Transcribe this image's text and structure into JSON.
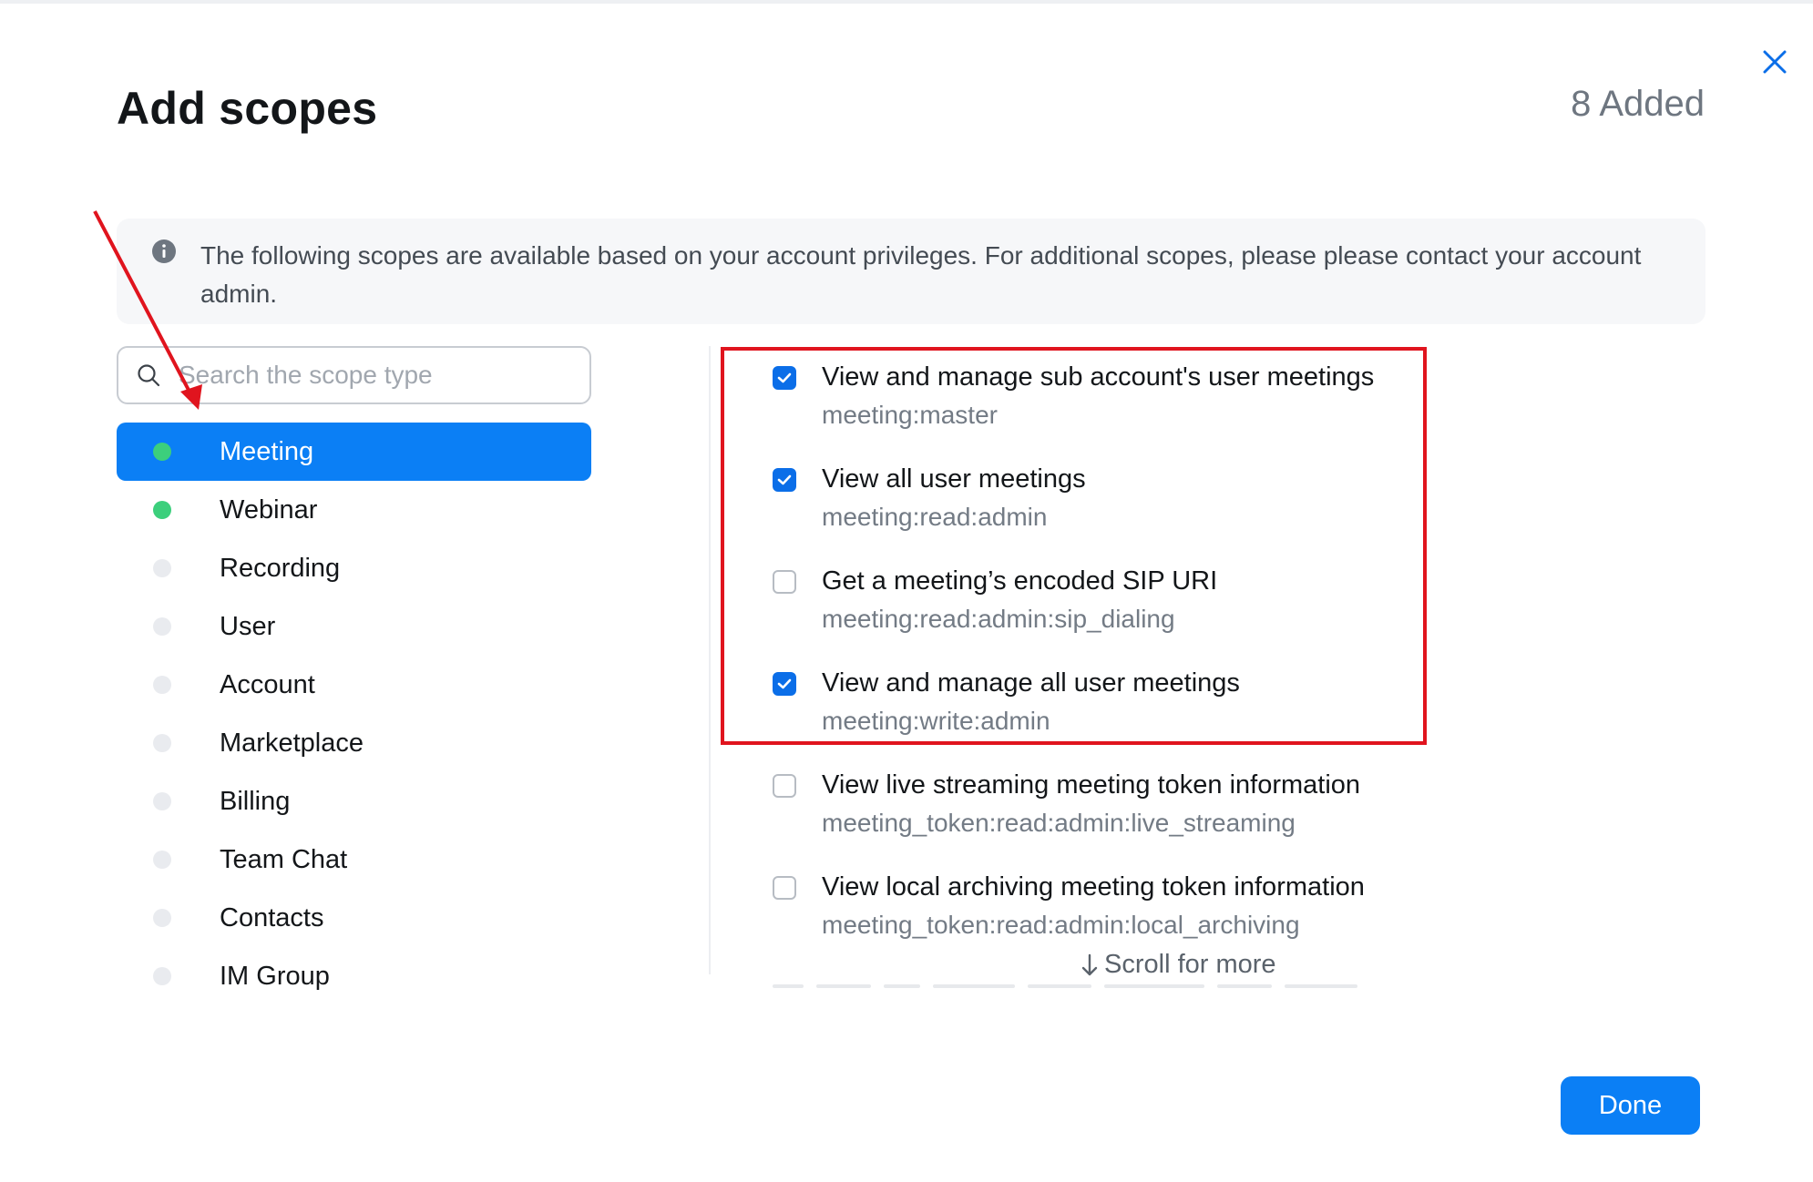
{
  "dialog": {
    "title": "Add scopes",
    "added_count": "8 Added",
    "close_icon": "close-icon",
    "notice_text": "The following scopes are available based on your account privileges. For additional scopes, please please contact your account admin.",
    "notice_icon": "info-icon"
  },
  "search": {
    "placeholder": "Search the scope type",
    "value": ""
  },
  "categories": [
    {
      "label": "Meeting",
      "status": "added",
      "active": true
    },
    {
      "label": "Webinar",
      "status": "added",
      "active": false
    },
    {
      "label": "Recording",
      "status": "none",
      "active": false
    },
    {
      "label": "User",
      "status": "none",
      "active": false
    },
    {
      "label": "Account",
      "status": "none",
      "active": false
    },
    {
      "label": "Marketplace",
      "status": "none",
      "active": false
    },
    {
      "label": "Billing",
      "status": "none",
      "active": false
    },
    {
      "label": "Team Chat",
      "status": "none",
      "active": false
    },
    {
      "label": "Contacts",
      "status": "none",
      "active": false
    },
    {
      "label": "IM Group",
      "status": "none",
      "active": false
    }
  ],
  "scopes": [
    {
      "label": "View and manage sub account's user meetings",
      "code": "meeting:master",
      "checked": true
    },
    {
      "label": "View all user meetings",
      "code": "meeting:read:admin",
      "checked": true
    },
    {
      "label": "Get a meeting’s encoded SIP URI",
      "code": "meeting:read:admin:sip_dialing",
      "checked": false
    },
    {
      "label": "View and manage all user meetings",
      "code": "meeting:write:admin",
      "checked": true
    },
    {
      "label": "View live streaming meeting token information",
      "code": "meeting_token:read:admin:live_streaming",
      "checked": false
    },
    {
      "label": "View local archiving meeting token information",
      "code": "meeting_token:read:admin:local_archiving",
      "checked": false
    }
  ],
  "scroll_hint": "Scroll for more",
  "done_label": "Done",
  "colors": {
    "accent": "#0b7ff5",
    "checkbox_checked": "#0b6ee8",
    "added_dot": "#3ccf7c",
    "annotation": "#e0141e"
  }
}
